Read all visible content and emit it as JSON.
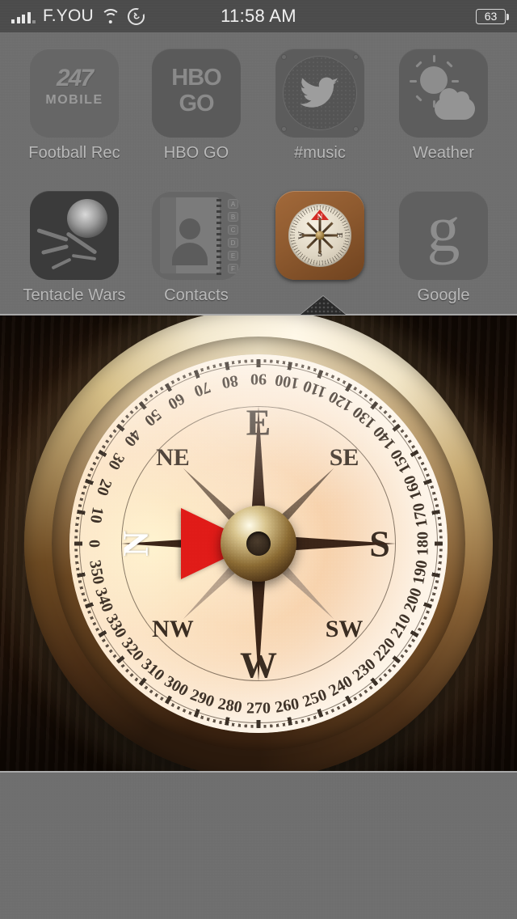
{
  "status_bar": {
    "carrier": "F.YOU",
    "signal_icon": "signal-bars-icon",
    "wifi_icon": "wifi-icon",
    "rotation_lock_icon": "rotation-lock-icon",
    "time": "11:58 AM",
    "battery_percent": "63",
    "battery_icon": "battery-icon"
  },
  "home_screen": {
    "apps": [
      {
        "label": "Football Rec",
        "icon": "football-rec-icon",
        "logo_top": "247",
        "logo_bottom": "MOBILE"
      },
      {
        "label": "HBO GO",
        "icon": "hbo-go-icon",
        "logo_top": "HBO",
        "logo_bottom": "GO"
      },
      {
        "label": "#music",
        "icon": "music-twitter-icon"
      },
      {
        "label": "Weather",
        "icon": "weather-icon"
      },
      {
        "label": "Tentacle Wars",
        "icon": "tentacle-wars-icon"
      },
      {
        "label": "Contacts",
        "icon": "contacts-icon",
        "tabs": [
          "A",
          "B",
          "C",
          "D",
          "E",
          "F"
        ]
      },
      {
        "label": "",
        "icon": "compass-app-icon",
        "selected": true
      },
      {
        "label": "Google",
        "icon": "google-icon",
        "glyph": "g"
      }
    ]
  },
  "folder": {
    "arrow_icon": "folder-arrow-up-icon",
    "open_app": "Compass"
  },
  "compass": {
    "heading_degrees": 90,
    "north_marker_label": "N",
    "cardinals": [
      {
        "label": "N",
        "bearing": 0
      },
      {
        "label": "NE",
        "bearing": 45
      },
      {
        "label": "E",
        "bearing": 90
      },
      {
        "label": "SE",
        "bearing": 135
      },
      {
        "label": "S",
        "bearing": 180
      },
      {
        "label": "SW",
        "bearing": 225
      },
      {
        "label": "W",
        "bearing": 270
      },
      {
        "label": "NW",
        "bearing": 315
      }
    ],
    "degree_labels": [
      "0",
      "10",
      "20",
      "30",
      "40",
      "50",
      "60",
      "70",
      "80",
      "90",
      "100",
      "110",
      "120",
      "130",
      "140",
      "150",
      "160",
      "170",
      "180",
      "190",
      "200",
      "210",
      "220",
      "230",
      "240",
      "250",
      "260",
      "270",
      "280",
      "290",
      "300",
      "310",
      "320",
      "330",
      "340",
      "350"
    ],
    "colors": {
      "north_needle": "#e01b18",
      "bezel_highlight": "#fff8e8",
      "dial_face": "#fbe4ca",
      "wood_background": "#25150a",
      "hub": "#8a6a33"
    }
  }
}
